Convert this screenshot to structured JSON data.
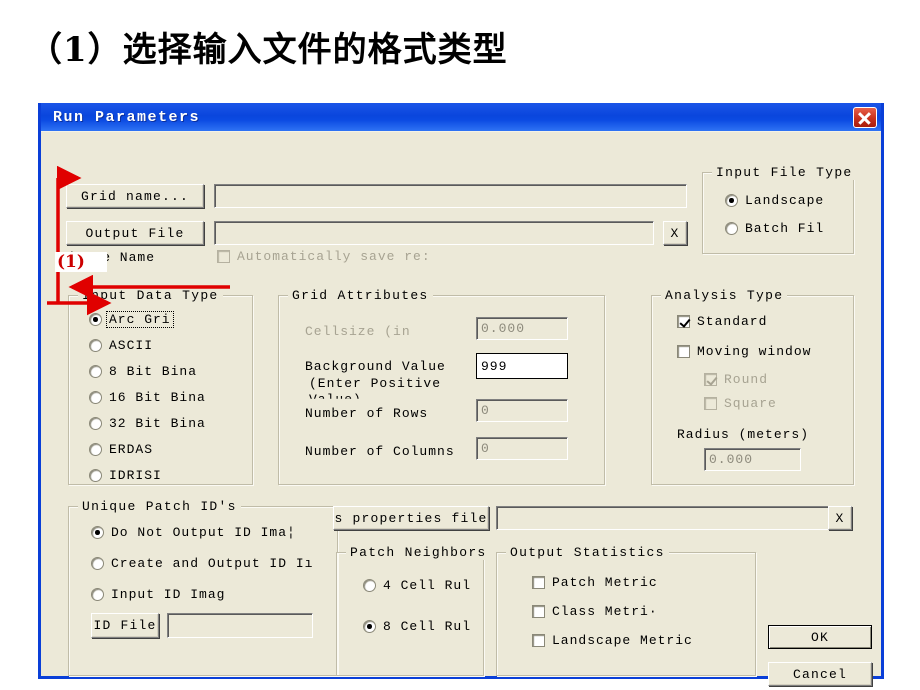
{
  "slide": {
    "title": "（1）选择输入文件的格式类型"
  },
  "dialog": {
    "title": "Run Parameters",
    "close_icon": "close-icon"
  },
  "top": {
    "grid_name_button": "Grid name...",
    "grid_name_value": "",
    "output_file_button": "Output File",
    "output_file_value": "",
    "output_file_clear_button": "X",
    "base_name_label": "(Base Name",
    "auto_save_checkbox": "Automatically save re:"
  },
  "input_file_type": {
    "title": "Input File Type",
    "options": [
      {
        "label": "Landscape",
        "checked": true
      },
      {
        "label": "Batch Fil",
        "checked": false
      }
    ]
  },
  "input_data_type": {
    "title": "Input Data Type",
    "options": [
      {
        "label": "Arc Gri",
        "checked": true
      },
      {
        "label": "ASCII",
        "checked": false
      },
      {
        "label": "8 Bit Bina",
        "checked": false
      },
      {
        "label": "16 Bit Bina",
        "checked": false
      },
      {
        "label": "32 Bit Bina",
        "checked": false
      },
      {
        "label": "ERDAS",
        "checked": false
      },
      {
        "label": "IDRISI",
        "checked": false
      }
    ]
  },
  "grid_attributes": {
    "title": "Grid Attributes",
    "cellsize_label": "Cellsize (in",
    "cellsize_value": "0.000",
    "background_label_line1": "Background Value",
    "background_label_line2": "(Enter Positive",
    "background_label_line3": "Value)",
    "background_value": "999",
    "rows_label": "Number of Rows",
    "rows_value": "0",
    "columns_label": "Number of Columns",
    "columns_value": "0"
  },
  "analysis_type": {
    "title": "Analysis Type",
    "standard": {
      "label": "Standard",
      "checked": true,
      "disabled": false
    },
    "moving_window": {
      "label": "Moving window",
      "checked": false,
      "disabled": false
    },
    "round": {
      "label": "Round",
      "checked": true,
      "disabled": true
    },
    "square": {
      "label": "Square",
      "checked": false,
      "disabled": true
    },
    "radius_label": "Radius (meters)",
    "radius_value": "0.000"
  },
  "unique_patch_ids": {
    "title": "Unique Patch ID's",
    "options": [
      {
        "label": "Do Not Output ID Ima¦",
        "checked": true
      },
      {
        "label": "Create and Output ID Iı",
        "checked": false
      },
      {
        "label": "Input ID Imag",
        "checked": false
      }
    ],
    "id_file_button": "ID File",
    "id_file_value": ""
  },
  "class_properties": {
    "button_label": "s properties file",
    "value": "",
    "clear_button": "X"
  },
  "patch_neighbors": {
    "title": "Patch Neighbors",
    "options": [
      {
        "label": "4 Cell Rul",
        "checked": false
      },
      {
        "label": "8 Cell Rul",
        "checked": true
      }
    ]
  },
  "output_statistics": {
    "title": "Output Statistics",
    "options": [
      {
        "label": "Patch Metric",
        "checked": false
      },
      {
        "label": "Class Metri·",
        "checked": false
      },
      {
        "label": "Landscape Metric",
        "checked": false
      }
    ]
  },
  "actions": {
    "ok_label": "OK",
    "cancel_label": "Cancel"
  },
  "annotations": {
    "number_label": "(1)",
    "color": "#e00000"
  }
}
